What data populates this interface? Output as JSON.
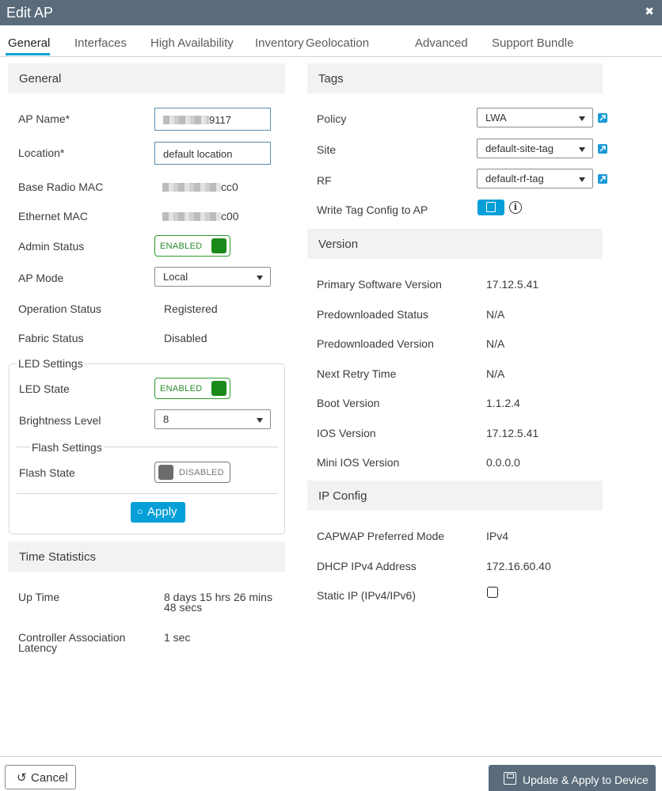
{
  "window": {
    "title": "Edit AP",
    "close_glyph": "✖"
  },
  "tabs": [
    {
      "label": "General",
      "active": true
    },
    {
      "label": "Interfaces"
    },
    {
      "label": "High Availability"
    },
    {
      "label": "Inventory"
    },
    {
      "label": "Geolocation"
    },
    {
      "label": "Advanced"
    },
    {
      "label": "Support Bundle"
    }
  ],
  "general": {
    "heading": "General",
    "ap_name": {
      "label": "AP Name*",
      "value_suffix": "9117"
    },
    "location": {
      "label": "Location*",
      "value": "default location"
    },
    "base_radio_mac": {
      "label": "Base Radio MAC",
      "value_suffix": "cc0"
    },
    "ethernet_mac": {
      "label": "Ethernet MAC",
      "value_suffix": "c00"
    },
    "admin_status": {
      "label": "Admin Status",
      "toggle": "ENABLED"
    },
    "ap_mode": {
      "label": "AP Mode",
      "value": "Local"
    },
    "operation_status": {
      "label": "Operation Status",
      "value": "Registered"
    },
    "fabric_status": {
      "label": "Fabric Status",
      "value": "Disabled"
    }
  },
  "led_settings": {
    "legend": "LED Settings",
    "led_state": {
      "label": "LED State",
      "toggle": "ENABLED"
    },
    "brightness": {
      "label": "Brightness Level",
      "value": "8"
    },
    "flash_legend": "Flash Settings",
    "flash_state": {
      "label": "Flash State",
      "toggle": "DISABLED"
    },
    "apply_label": "Apply"
  },
  "time_statistics": {
    "heading": "Time Statistics",
    "up_time": {
      "label": "Up Time",
      "value_line1": "8 days 15 hrs 26 mins",
      "value_line2": "48 secs"
    },
    "latency": {
      "label_line1": "Controller Association",
      "label_line2": "Latency",
      "value": "1 sec"
    }
  },
  "tags": {
    "heading": "Tags",
    "policy": {
      "label": "Policy",
      "value": "LWA"
    },
    "site": {
      "label": "Site",
      "value": "default-site-tag"
    },
    "rf": {
      "label": "RF",
      "value": "default-rf-tag"
    },
    "write_tag": {
      "label": "Write Tag Config to AP"
    }
  },
  "version": {
    "heading": "Version",
    "rows": [
      {
        "label": "Primary Software Version",
        "value": "17.12.5.41"
      },
      {
        "label": "Predownloaded Status",
        "value": "N/A"
      },
      {
        "label": "Predownloaded Version",
        "value": "N/A"
      },
      {
        "label": "Next Retry Time",
        "value": "N/A"
      },
      {
        "label": "Boot Version",
        "value": "1.1.2.4"
      },
      {
        "label": "IOS Version",
        "value": "17.12.5.41"
      },
      {
        "label": "Mini IOS Version",
        "value": "0.0.0.0"
      }
    ]
  },
  "ip_config": {
    "heading": "IP Config",
    "capwap": {
      "label": "CAPWAP Preferred Mode",
      "value": "IPv4"
    },
    "dhcp": {
      "label": "DHCP IPv4 Address",
      "value": "172.16.60.40"
    },
    "static_ip": {
      "label": "Static IP (IPv4/IPv6)",
      "checked": false
    }
  },
  "footer": {
    "cancel_label": "Cancel",
    "update_label": "Update & Apply to Device"
  },
  "colors": {
    "accent": "#049fd9",
    "header": "#5a6b7b",
    "enabled_green": "#1a8a1a"
  }
}
